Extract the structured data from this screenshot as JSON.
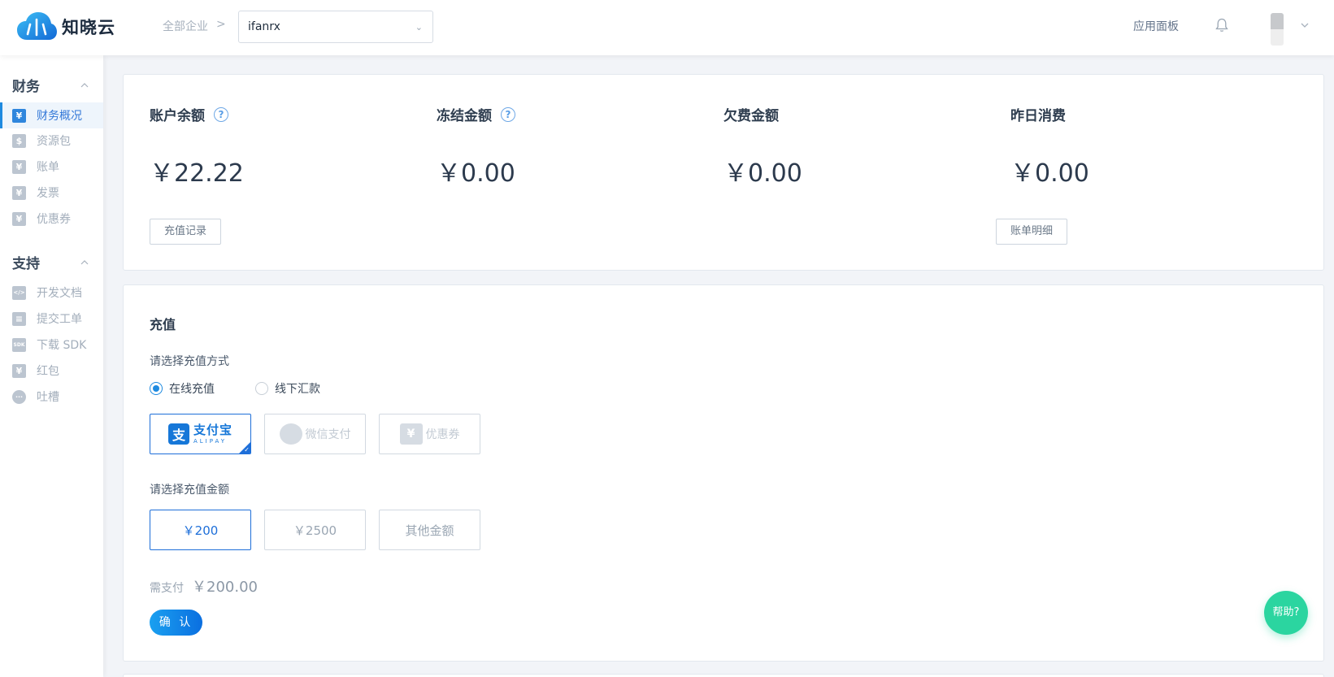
{
  "header": {
    "logo_text": "知晓云",
    "breadcrumb_root": "全部企业",
    "breadcrumb_sep": ">",
    "org_select_value": "ifanrx",
    "app_panel_label": "应用面板"
  },
  "sidebar": {
    "sections": [
      {
        "title": "财务",
        "items": [
          {
            "label": "财务概况",
            "icon": "yen-icon",
            "glyph": "¥",
            "active": true
          },
          {
            "label": "资源包",
            "icon": "package-icon",
            "glyph": "$"
          },
          {
            "label": "账单",
            "icon": "bill-icon",
            "glyph": "¥"
          },
          {
            "label": "发票",
            "icon": "invoice-icon",
            "glyph": "¥"
          },
          {
            "label": "优惠券",
            "icon": "coupon-icon",
            "glyph": "¥"
          }
        ]
      },
      {
        "title": "支持",
        "items": [
          {
            "label": "开发文档",
            "icon": "code-doc-icon",
            "glyph": "</>"
          },
          {
            "label": "提交工单",
            "icon": "ticket-icon",
            "glyph": "≡"
          },
          {
            "label": "下载 SDK",
            "icon": "sdk-download-icon",
            "glyph": "SDK"
          },
          {
            "label": "红包",
            "icon": "red-packet-icon",
            "glyph": "¥"
          },
          {
            "label": "吐槽",
            "icon": "chat-bubble-icon",
            "glyph": "···"
          }
        ]
      }
    ]
  },
  "overview": {
    "stats": [
      {
        "label": "账户余额",
        "value": "￥22.22",
        "has_help": true
      },
      {
        "label": "冻结金额",
        "value": "￥0.00",
        "has_help": true
      },
      {
        "label": "欠费金额",
        "value": "￥0.00",
        "has_help": false
      },
      {
        "label": "昨日消费",
        "value": "￥0.00",
        "has_help": false
      }
    ],
    "help_glyph": "?",
    "recharge_record_button": "充值记录",
    "bill_detail_button": "账单明细"
  },
  "recharge": {
    "title": "充值",
    "method_label": "请选择充值方式",
    "methods": [
      {
        "label": "在线充值",
        "selected": true
      },
      {
        "label": "线下汇款",
        "selected": false
      }
    ],
    "channels": {
      "alipay_zh": "支付宝",
      "alipay_en": "ALIPAY",
      "alipay_glyph": "支",
      "wechat": "微信支付",
      "coupon": "优惠券",
      "coupon_glyph": "¥"
    },
    "amount_label": "请选择充值金额",
    "amounts": [
      "￥200",
      "￥2500",
      "其他金额"
    ],
    "selected_amount_index": 0,
    "pay_label": "需支付",
    "pay_value": "￥200.00",
    "confirm_button": "确 认"
  },
  "help_button": "帮助?",
  "colors": {
    "accent": "#1e8ae0",
    "selected_border": "#1e6fd9",
    "help": "#2bd5a0"
  }
}
